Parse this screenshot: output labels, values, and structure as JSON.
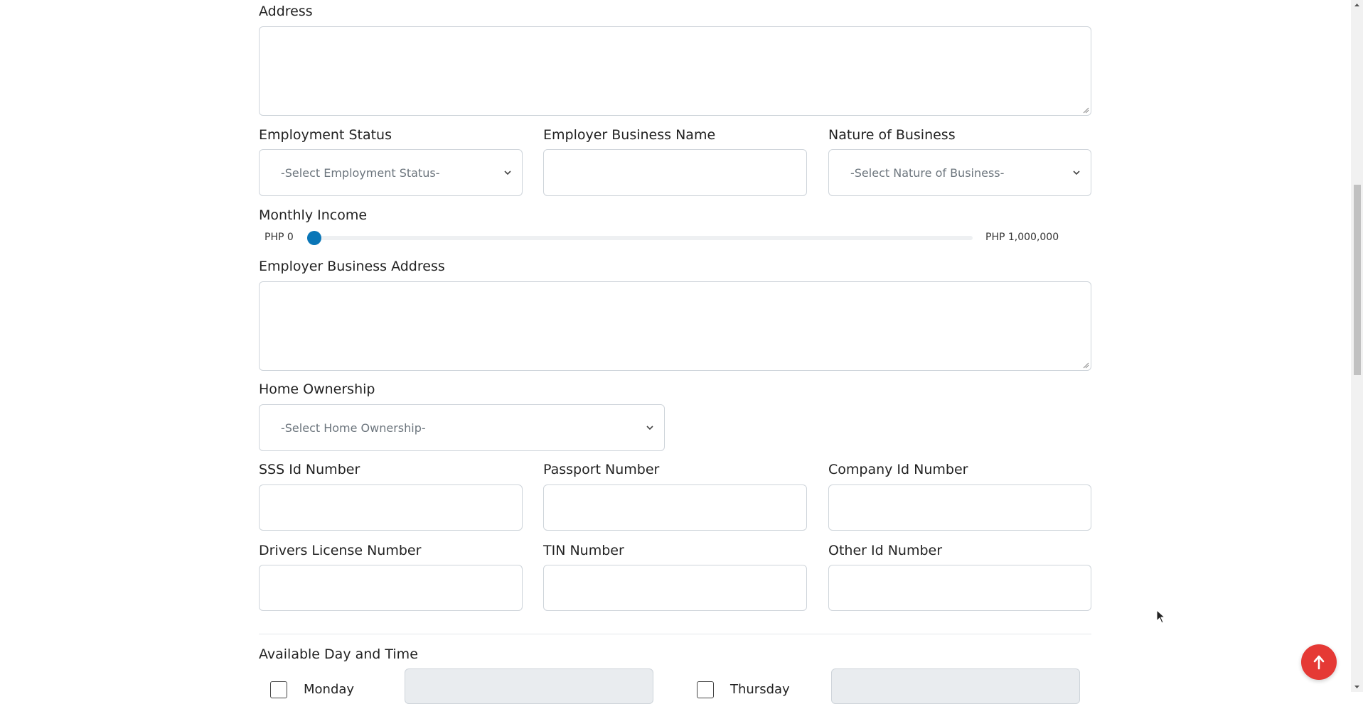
{
  "address": {
    "label": "Address"
  },
  "employment_status": {
    "label": "Employment Status",
    "placeholder": "-Select Employment Status-"
  },
  "employer_business_name": {
    "label": "Employer Business Name",
    "value": ""
  },
  "nature_of_business": {
    "label": "Nature of Business",
    "placeholder": "-Select Nature of Business-"
  },
  "monthly_income": {
    "label": "Monthly Income",
    "min_label": "PHP 0",
    "max_label": "PHP 1,000,000",
    "value_fraction": 0.0
  },
  "employer_business_address": {
    "label": "Employer Business Address"
  },
  "home_ownership": {
    "label": "Home Ownership",
    "placeholder": "-Select Home Ownership-"
  },
  "sss_id": {
    "label": "SSS Id Number"
  },
  "passport": {
    "label": "Passport Number"
  },
  "company_id": {
    "label": "Company Id Number"
  },
  "drivers_license": {
    "label": "Drivers License Number"
  },
  "tin": {
    "label": "TIN Number"
  },
  "other_id": {
    "label": "Other Id Number"
  },
  "availability": {
    "title": "Available Day and Time",
    "days": [
      "Monday",
      "Thursday"
    ]
  },
  "colors": {
    "accent": "#0a76b7",
    "scroll_top_button": "#e53935",
    "border": "#ced4da"
  },
  "icons": {
    "select_arrow": "chevron-down-icon",
    "scroll_top": "arrow-up-icon"
  }
}
